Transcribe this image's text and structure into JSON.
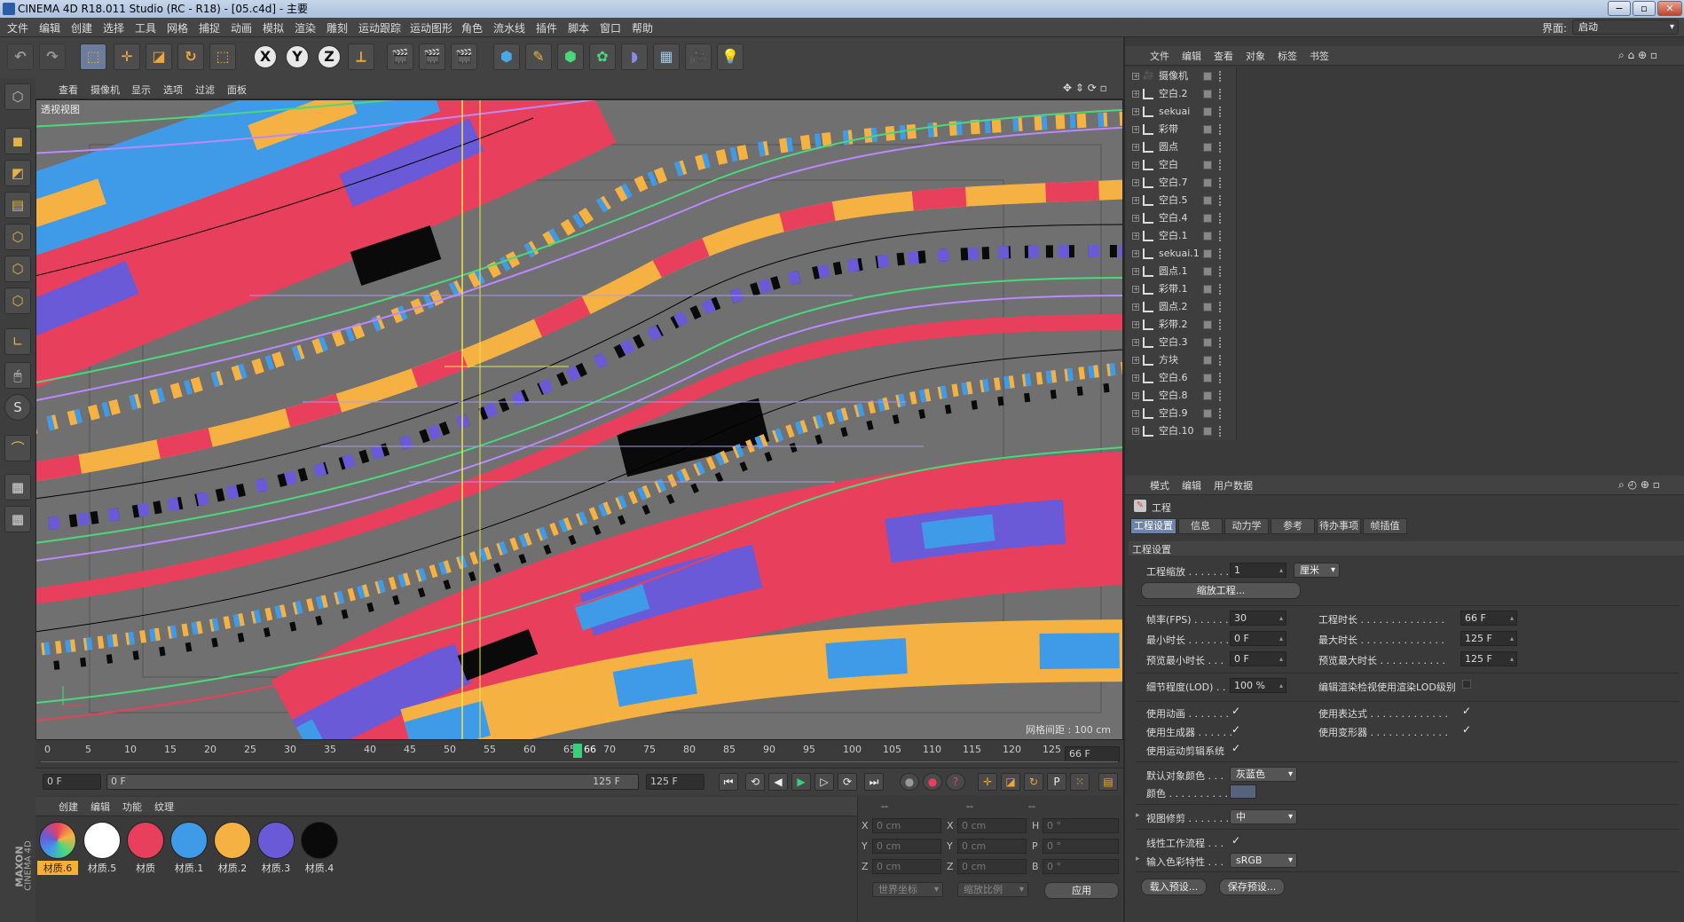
{
  "window": {
    "title": "CINEMA 4D R18.011 Studio (RC - R18) - [05.c4d] - 主要",
    "min": "−",
    "max": "▫",
    "close": "✕"
  },
  "menu": [
    "文件",
    "编辑",
    "创建",
    "选择",
    "工具",
    "网格",
    "捕捉",
    "动画",
    "模拟",
    "渲染",
    "雕刻",
    "运动跟踪",
    "运动图形",
    "角色",
    "流水线",
    "插件",
    "脚本",
    "窗口",
    "帮助"
  ],
  "layout": {
    "label": "界面:",
    "value": "启动"
  },
  "toolbar": {
    "x": "X",
    "y": "Y",
    "z": "Z"
  },
  "viewport": {
    "menu": [
      "查看",
      "摄像机",
      "显示",
      "选项",
      "过滤",
      "面板"
    ],
    "label": "透视视图",
    "grid": "网格间距 : 100 cm"
  },
  "timeline": {
    "ticks": [
      "0",
      "5",
      "10",
      "15",
      "20",
      "25",
      "30",
      "35",
      "40",
      "45",
      "50",
      "55",
      "60",
      "65",
      "70",
      "75",
      "80",
      "85",
      "90",
      "95",
      "100",
      "105",
      "110",
      "115",
      "120",
      "125"
    ],
    "current": "66",
    "end_field": "66 F"
  },
  "transport": {
    "start": "0 F",
    "range_start": "0 F",
    "range_end": "125 F",
    "end": "125 F"
  },
  "materials": {
    "menu": [
      "创建",
      "编辑",
      "功能",
      "纹理"
    ],
    "items": [
      {
        "name": "材质.6",
        "color": "#9a9a9a"
      },
      {
        "name": "材质.5",
        "color": "#ffffff"
      },
      {
        "name": "材质",
        "color": "#e8405c"
      },
      {
        "name": "材质.1",
        "color": "#3f9ae8"
      },
      {
        "name": "材质.2",
        "color": "#f5b242"
      },
      {
        "name": "材质.3",
        "color": "#6a5ad8"
      },
      {
        "name": "材质.4",
        "color": "#0a0a0a"
      }
    ]
  },
  "brand": {
    "line1": "MAXON",
    "line2": "CINEMA 4D"
  },
  "coords": {
    "head": [
      "--",
      "--",
      "--"
    ],
    "rows": [
      {
        "a": "X",
        "av": "0 cm",
        "b": "X",
        "bv": "0 cm",
        "c": "H",
        "cv": "0 °"
      },
      {
        "a": "Y",
        "av": "0 cm",
        "b": "Y",
        "bv": "0 cm",
        "c": "P",
        "cv": "0 °"
      },
      {
        "a": "Z",
        "av": "0 cm",
        "b": "Z",
        "bv": "0 cm",
        "c": "B",
        "cv": "0 °"
      }
    ],
    "world": "世界坐标",
    "scale": "缩放比例",
    "apply": "应用"
  },
  "objects": {
    "menu": [
      "文件",
      "编辑",
      "查看",
      "对象",
      "标签",
      "书签"
    ],
    "items": [
      "摄像机",
      "空白.2",
      "sekuai",
      "彩带",
      "圆点",
      "空白",
      "空白.7",
      "空白.5",
      "空白.4",
      "空白.1",
      "sekuai.1",
      "圆点.1",
      "彩带.1",
      "圆点.2",
      "彩带.2",
      "空白.3",
      "方块",
      "空白.6",
      "空白.8",
      "空白.9",
      "空白.10"
    ]
  },
  "attributes": {
    "menu": [
      "模式",
      "编辑",
      "用户数据"
    ],
    "title": "工程",
    "tabs": [
      "工程设置",
      "信息",
      "动力学",
      "参考",
      "待办事项",
      "帧插值"
    ],
    "section": "工程设置",
    "scale_label": "工程缩放 . . . . . . .",
    "scale_value": "1",
    "scale_unit": "厘米",
    "scale_btn": "缩放工程...",
    "fps_label": "帧率(FPS) . . . . . .",
    "fps": "30",
    "time_label": "工程时长 . . . . . . . . . . . . . .",
    "time": "66 F",
    "min_label": "最小时长 . . . . . . .",
    "min": "0 F",
    "max_label": "最大时长 . . . . . . . . . . . . . .",
    "max": "125 F",
    "pmin_label": "预览最小时长 . . .",
    "pmin": "0 F",
    "pmax_label": "预览最大时长 . . . . . . . . . . .",
    "pmax": "125 F",
    "lod_label": "细节程度(LOD) . . .",
    "lod": "100 %",
    "lod_r_label": "编辑渲染检视使用渲染LOD级别",
    "anim_label": "使用动画 . . . . . . .",
    "expr_label": "使用表达式 . . . . . . . . . . . . .",
    "gen_label": "使用生成器 . . . . . .",
    "def_label": "使用变形器 . . . . . . . . . . . . .",
    "mt_label": "使用运动剪辑系统",
    "objcol_label": "默认对象颜色 . . .",
    "objcol": "灰蓝色",
    "col_label": "颜色 . . . . . . . . . .",
    "clip_label": "视图修剪 . . . . . . .",
    "clip": "中",
    "linear_label": "线性工作流程 . . .",
    "cp_label": "输入色彩特性 . . .",
    "cp": "sRGB",
    "load": "载入预设...",
    "save": "保存预设...",
    "check": "✓"
  }
}
